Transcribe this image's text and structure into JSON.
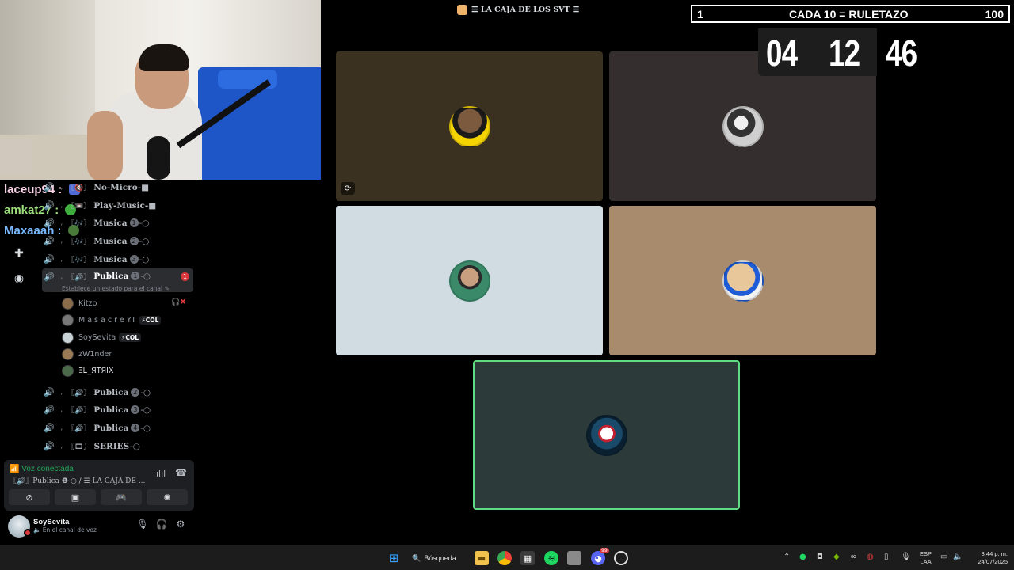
{
  "chat": [
    {
      "user": "laceup94",
      "suffix": " :",
      "color": "#ffd6e8"
    },
    {
      "user": "amkat27",
      "suffix": " :",
      "color": "#9be07a"
    },
    {
      "user": "Maxaaah",
      "suffix": " :",
      "color": "#78b8ff"
    }
  ],
  "channels": [
    {
      "icon": "🔇",
      "name": "No-Micro-■",
      "num": "",
      "suffix": ""
    },
    {
      "icon": "📼",
      "name": "Play-Music-■",
      "num": "",
      "suffix": ""
    },
    {
      "icon": "🎶",
      "name": "Musica",
      "num": "1",
      "suffix": "-○"
    },
    {
      "icon": "🎶",
      "name": "Musica",
      "num": "2",
      "suffix": "-○"
    },
    {
      "icon": "🎶",
      "name": "Musica",
      "num": "3",
      "suffix": "-○"
    }
  ],
  "active_channel": {
    "name": "Publica",
    "num": "1",
    "suffix": "-○",
    "status": "Establece un estado para el canal",
    "badge": "1"
  },
  "members": [
    {
      "name": "Kitzo",
      "tag": "",
      "color": "#8a6b4a"
    },
    {
      "name": "M a s a c r e YT",
      "tag": "⚡COL",
      "color": "#777"
    },
    {
      "name": "SoySevita",
      "tag": "⚡COL",
      "color": "#c8d3d8"
    },
    {
      "name": "zW1nder",
      "tag": "",
      "color": "#9a7a55"
    },
    {
      "name": "ΞᏞ_ЯΤЯΙХ",
      "tag": "",
      "color": "#4a6a4a"
    }
  ],
  "channels_after": [
    {
      "icon": "🔊",
      "name": "Publica",
      "num": "2",
      "suffix": "-○"
    },
    {
      "icon": "🔊",
      "name": "Publica",
      "num": "3",
      "suffix": "-○"
    },
    {
      "icon": "🔊",
      "name": "Publica",
      "num": "4",
      "suffix": "-○"
    },
    {
      "icon": "🎞",
      "name": "SERIES",
      "num": "",
      "suffix": "-○"
    }
  ],
  "voice": {
    "status": "Voz conectada",
    "channel": "〖🔊〗Publica ❶-○ / ☰ LA CAJA DE ..."
  },
  "user": {
    "name": "SoySevita",
    "subtitle": "En el canal de voz"
  },
  "call_title": "☰ LA CAJA DE LOS SVT ☰",
  "tiles": [
    {
      "bg": "#3a3120",
      "avatar_bg": "radial-gradient(circle at 50% 35%, #7b5a3e 0 38%, #1a1a1a 39% 55%, #f5d400 56%)"
    },
    {
      "bg": "#352e2e",
      "avatar_bg": "radial-gradient(circle at 45% 40%, #f0f0f0 0 22%, #333 23% 45%, #cfcfcf 46%)"
    },
    {
      "bg": "#d0dce2",
      "avatar_bg": "radial-gradient(circle at 50% 40%, #c8a080 0 30%, #2a2a2a 31% 40%, #3a8a6a 41%)"
    },
    {
      "bg": "#a88a6c",
      "avatar_bg": "radial-gradient(circle at 45% 40%, #e8c79b 0 45%, #1e5bd6 46% 60%, #f2f2f2 61%)"
    },
    {
      "bg": "#2d3a3a",
      "avatar_bg": "radial-gradient(circle at 50% 45%, #ffffff 0 22%, #c21f2f 23% 30%, #1a4a6a 31% 55%, #0a2030 56%)"
    }
  ],
  "banner": {
    "left": "1",
    "middle": "CADA 10 = RULETAZO",
    "right": "100"
  },
  "timer": [
    "04",
    "12",
    "46"
  ],
  "taskbar": {
    "search": "Búsqueda",
    "discord_badge": "99"
  },
  "lang": {
    "line1": "ESP",
    "line2": "LAA"
  },
  "clock": {
    "time": "8:44 p. m.",
    "date": "24/07/2025"
  }
}
